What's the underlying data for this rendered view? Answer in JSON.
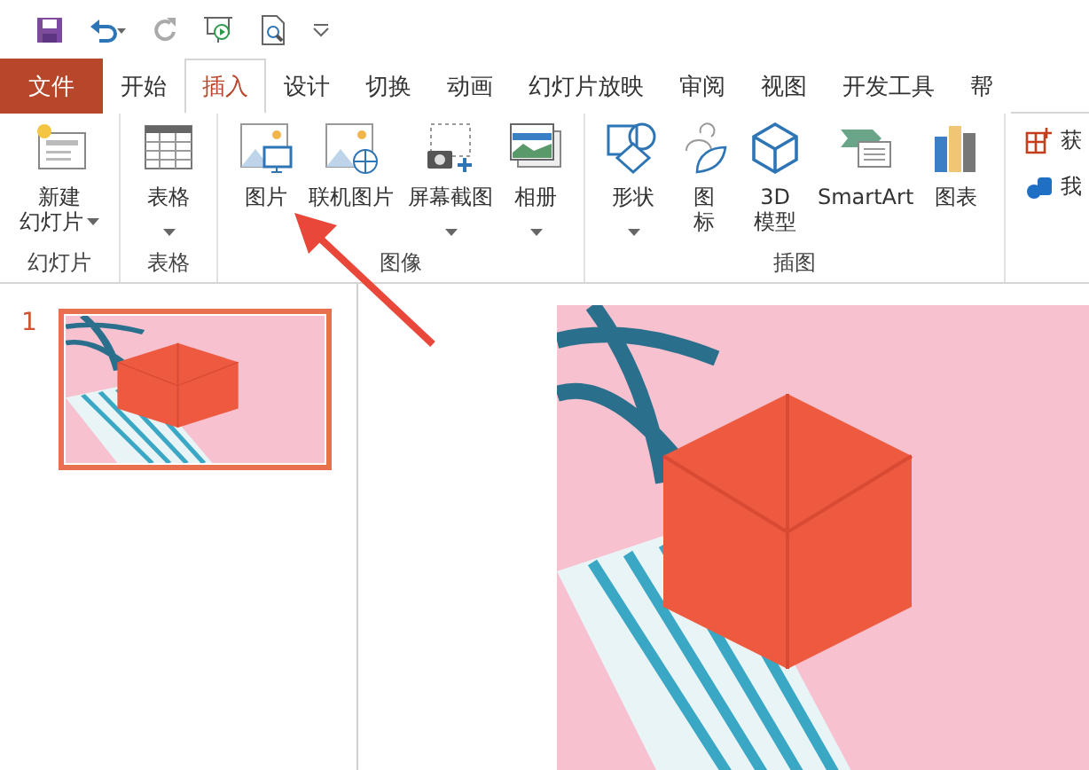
{
  "tabs": [
    {
      "label": "文件",
      "kind": "file",
      "selected": false
    },
    {
      "label": "开始",
      "kind": "tab",
      "selected": false
    },
    {
      "label": "插入",
      "kind": "tab",
      "selected": true
    },
    {
      "label": "设计",
      "kind": "tab",
      "selected": false
    },
    {
      "label": "切换",
      "kind": "tab",
      "selected": false
    },
    {
      "label": "动画",
      "kind": "tab",
      "selected": false
    },
    {
      "label": "幻灯片放映",
      "kind": "tab",
      "selected": false
    },
    {
      "label": "审阅",
      "kind": "tab",
      "selected": false
    },
    {
      "label": "视图",
      "kind": "tab",
      "selected": false
    },
    {
      "label": "开发工具",
      "kind": "tab",
      "selected": false
    },
    {
      "label": "帮",
      "kind": "tab",
      "selected": false
    }
  ],
  "groups": [
    {
      "label": "幻灯片",
      "buttons": [
        {
          "lines": [
            "新建",
            "幻灯片"
          ],
          "kind": "slide",
          "dropdown": true
        }
      ]
    },
    {
      "label": "表格",
      "buttons": [
        {
          "lines": [
            "表格"
          ],
          "kind": "table",
          "dropdown": true
        }
      ]
    },
    {
      "label": "图像",
      "buttons": [
        {
          "lines": [
            "图片"
          ],
          "kind": "picture",
          "dropdown": false
        },
        {
          "lines": [
            "联机图片"
          ],
          "kind": "online",
          "dropdown": false
        },
        {
          "lines": [
            "屏幕截图"
          ],
          "kind": "screenshot",
          "dropdown": true
        },
        {
          "lines": [
            "相册"
          ],
          "kind": "album",
          "dropdown": true
        }
      ]
    },
    {
      "label": "插图",
      "buttons": [
        {
          "lines": [
            "形状"
          ],
          "kind": "shapes",
          "dropdown": true
        },
        {
          "lines": [
            "图",
            "标"
          ],
          "kind": "icons",
          "dropdown": false
        },
        {
          "lines": [
            "3D",
            "模型"
          ],
          "kind": "cube",
          "dropdown": false
        },
        {
          "lines": [
            "SmartArt"
          ],
          "kind": "smartart",
          "dropdown": false
        },
        {
          "lines": [
            "图表"
          ],
          "kind": "chart",
          "dropdown": false
        }
      ]
    },
    {
      "buttons": [
        {
          "lines": [
            "获"
          ],
          "kind": "addin",
          "dropdown": false
        },
        {
          "lines": [
            "我"
          ],
          "kind": "myaddin",
          "dropdown": false
        }
      ]
    }
  ],
  "slides": [
    {
      "number": "1",
      "selected": true
    }
  ]
}
